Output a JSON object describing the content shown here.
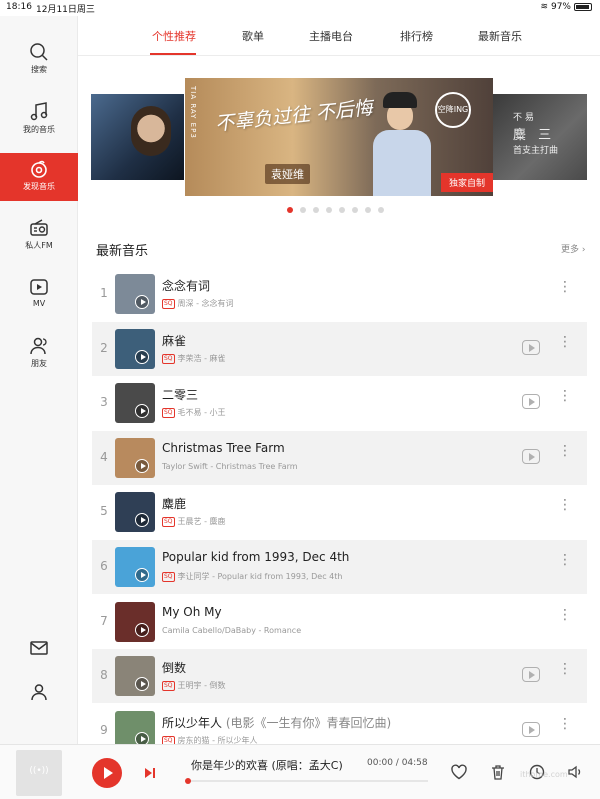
{
  "status": {
    "time": "18:16",
    "date": "12月11日周三",
    "battery": "97%"
  },
  "sidebar": {
    "items": [
      {
        "label": "搜索",
        "icon": "search-icon"
      },
      {
        "label": "我的音乐",
        "icon": "music-note-icon"
      },
      {
        "label": "发现音乐",
        "icon": "netease-logo-icon",
        "active": true
      },
      {
        "label": "私人FM",
        "icon": "radio-icon"
      },
      {
        "label": "MV",
        "icon": "video-play-icon"
      },
      {
        "label": "朋友",
        "icon": "friends-icon"
      }
    ],
    "bottom_icons": [
      "mail-icon",
      "user-icon"
    ]
  },
  "tabs": [
    {
      "label": "个性推荐",
      "active": true
    },
    {
      "label": "歌单"
    },
    {
      "label": "主播电台"
    },
    {
      "label": "排行榜"
    },
    {
      "label": "最新音乐"
    }
  ],
  "banner": {
    "side_text": "TIA RAY EP3",
    "title": "不辜负过往 不后悔",
    "artist": "袁娅维",
    "logo": "空降ING",
    "badge": "独家自制",
    "right_card_lines": [
      "不  易",
      "麋  三",
      "首支主打曲"
    ],
    "active_index": 0,
    "dot_count": 8
  },
  "section": {
    "title": "最新音乐",
    "more": "更多 ›"
  },
  "songs": [
    {
      "num": "1",
      "title": "念念有词",
      "subtitle": "",
      "sq": true,
      "meta": "周深 - 念念有词",
      "mv": false,
      "cover": "#7d8a98"
    },
    {
      "num": "2",
      "title": "麻雀",
      "subtitle": "",
      "sq": true,
      "meta": "李荣浩 - 麻雀",
      "mv": true,
      "cover": "#3d5f7a"
    },
    {
      "num": "3",
      "title": "二零三",
      "subtitle": "",
      "sq": true,
      "meta": "毛不易 - 小王",
      "mv": true,
      "cover": "#4a4a4a"
    },
    {
      "num": "4",
      "title": "Christmas Tree Farm",
      "subtitle": "",
      "sq": false,
      "meta": "Taylor Swift - Christmas Tree Farm",
      "mv": true,
      "cover": "#b88a5e"
    },
    {
      "num": "5",
      "title": "麋鹿",
      "subtitle": "",
      "sq": true,
      "meta": "王晨艺 - 麋鹿",
      "mv": false,
      "cover": "#2f3f55"
    },
    {
      "num": "6",
      "title": "Popular kid from 1993, Dec 4th",
      "subtitle": "",
      "sq": true,
      "meta": "李让同学 - Popular kid from 1993, Dec 4th",
      "mv": false,
      "cover": "#4aa3d8"
    },
    {
      "num": "7",
      "title": "My Oh My",
      "subtitle": "",
      "sq": false,
      "meta": "Camila Cabello/DaBaby - Romance",
      "mv": false,
      "cover": "#6a2e2a"
    },
    {
      "num": "8",
      "title": "倒数",
      "subtitle": "",
      "sq": true,
      "meta": "王明宇 - 倒数",
      "mv": true,
      "cover": "#8a8478"
    },
    {
      "num": "9",
      "title": "所以少年人",
      "subtitle": "(电影《一生有你》青春回忆曲)",
      "sq": true,
      "meta": "房东的猫 - 所以少年人",
      "mv": true,
      "cover": "#6f8f6a"
    }
  ],
  "player": {
    "now_playing": "你是年少的欢喜 (原唱：孟大C)",
    "time": "00:00 / 04:58",
    "progress": 0
  },
  "watermark": "ithome.com"
}
